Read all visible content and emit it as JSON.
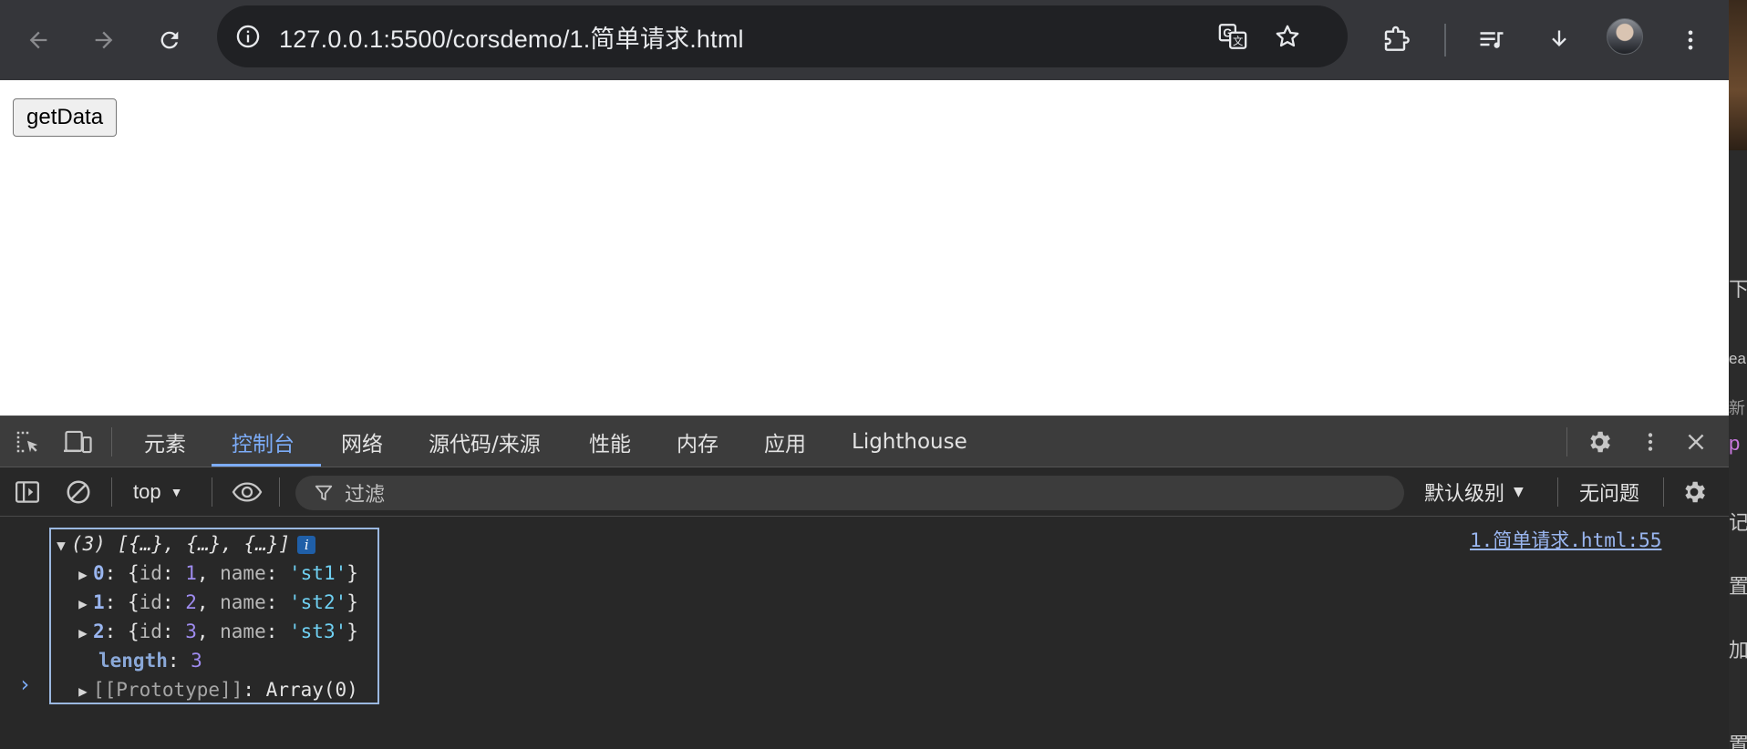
{
  "browser": {
    "url": "127.0.0.1:5500/corsdemo/1.简单请求.html",
    "icons": [
      "back-arrow-icon",
      "forward-arrow-icon",
      "reload-icon",
      "site-info-icon",
      "translate-icon",
      "bookmark-star-icon",
      "extensions-icon",
      "reading-list-icon",
      "download-icon",
      "kebab-menu-icon"
    ]
  },
  "page": {
    "button_label": "getData"
  },
  "devtools": {
    "tabs": [
      "元素",
      "控制台",
      "网络",
      "源代码/来源",
      "性能",
      "内存",
      "应用",
      "Lighthouse"
    ],
    "active_tab": "控制台",
    "context": "top",
    "filter_placeholder": "过滤",
    "levels": "默认级别",
    "issues": "无问题",
    "console": {
      "summary": "(3) [{…}, {…}, {…}]",
      "info_badge": "i",
      "source": "1.简单请求.html:55",
      "items": [
        {
          "index": "0",
          "id": "1",
          "name": "'st1'"
        },
        {
          "index": "1",
          "id": "2",
          "name": "'st2'"
        },
        {
          "index": "2",
          "id": "3",
          "name": "'st3'"
        }
      ],
      "length_key": "length",
      "length_value": "3",
      "proto_key": "[[Prototype]]",
      "proto_value": "Array(0)",
      "prompt": "›"
    }
  },
  "edge_strip": {
    "texts": [
      "下",
      "ea",
      "新",
      "p",
      "记",
      "置",
      "加",
      "置"
    ]
  },
  "colors": {
    "active_tab": "#7cacf8",
    "number": "#9f8cf0",
    "string": "#6fd0f2",
    "key": "#9ab6f0"
  }
}
